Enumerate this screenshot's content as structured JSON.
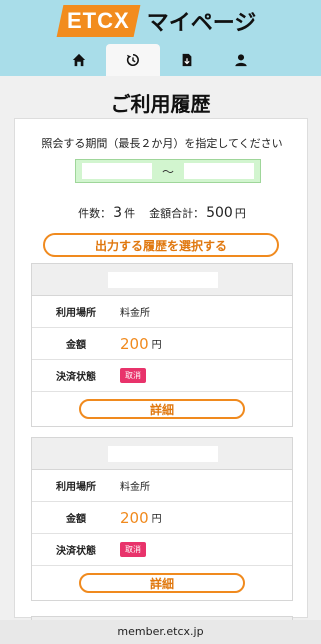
{
  "header": {
    "logo": "ETCX",
    "title": "マイページ"
  },
  "tabs": [
    {
      "icon": "home-icon",
      "active": false
    },
    {
      "icon": "history-icon",
      "active": true
    },
    {
      "icon": "document-icon",
      "active": false
    },
    {
      "icon": "user-icon",
      "active": false
    }
  ],
  "page_title": "ご利用履歴",
  "period": {
    "label": "照会する期間（最長２か月）を指定してください",
    "separator": "〜"
  },
  "summary": {
    "count_label": "件数：",
    "count": "3",
    "count_unit": "件",
    "total_label": "金額合計：",
    "total": "500",
    "total_unit": "円"
  },
  "select_button": "出力する履歴を選択する",
  "cards": [
    {
      "place_label": "利用場所",
      "place": "料金所",
      "amount_label": "金額",
      "amount": "200",
      "unit": "円",
      "status_label": "決済状態",
      "status": "取消",
      "detail": "詳細"
    },
    {
      "place_label": "利用場所",
      "place": "料金所",
      "amount_label": "金額",
      "amount": "200",
      "unit": "円",
      "status_label": "決済状態",
      "status": "取消",
      "detail": "詳細"
    }
  ],
  "footer": {
    "url": "member.etcx.jp"
  },
  "colors": {
    "header_bg": "#a9dde9",
    "accent": "#f08a1e",
    "badge": "#e8336b",
    "date_bg": "#d2f5cf"
  }
}
